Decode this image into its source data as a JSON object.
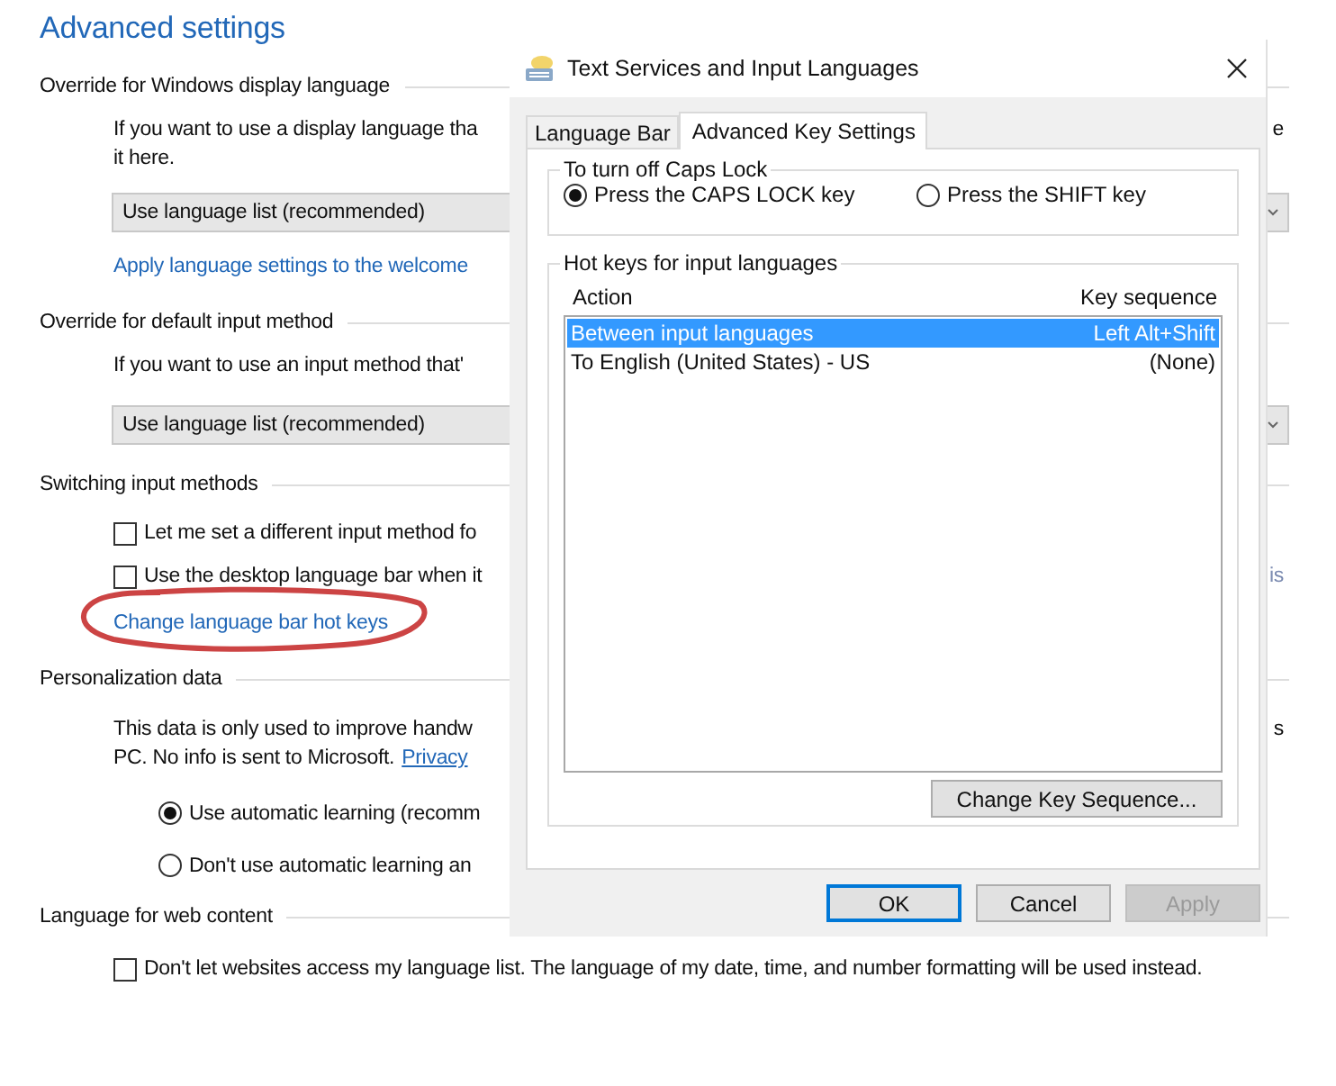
{
  "page": {
    "title": "Advanced settings",
    "sections": [
      {
        "heading": "Override for Windows display language",
        "items": [
          {
            "kind": "text",
            "lines": [
              "If you want to use a display language tha",
              "it here."
            ],
            "fragment": "e"
          },
          {
            "kind": "dropdown",
            "value": "Use language list (recommended)"
          },
          {
            "kind": "link",
            "text": "Apply language settings to the welcome"
          }
        ]
      },
      {
        "heading": "Override for default input method",
        "items": [
          {
            "kind": "text",
            "lines": [
              "If you want to use an input method that'"
            ]
          },
          {
            "kind": "dropdown",
            "value": "Use language list (recommended)"
          }
        ]
      },
      {
        "heading": "Switching input methods",
        "items": [
          {
            "kind": "checkbox",
            "label": "Let me set a different input method fo",
            "checked": false
          },
          {
            "kind": "checkbox",
            "label": "Use the desktop language bar when it",
            "checked": false,
            "fragment": "is"
          },
          {
            "kind": "link",
            "text": "Change language bar hot keys",
            "circled": true
          }
        ]
      },
      {
        "heading": "Personalization data",
        "items": [
          {
            "kind": "text",
            "lines": [
              "This data is only used to improve handw"
            ],
            "fragment": "s"
          },
          {
            "kind": "text_link",
            "text": "PC. No info is sent to Microsoft.",
            "link": "Privacy"
          },
          {
            "kind": "radio",
            "label": "Use automatic learning (recomm",
            "selected": true
          },
          {
            "kind": "radio",
            "label": "Don't use automatic learning an",
            "selected": false
          }
        ]
      },
      {
        "heading": "Language for web content",
        "items": [
          {
            "kind": "checkbox",
            "label": "Don't let websites access my language list. The language of my date, time, and number formatting will be used instead.",
            "checked": false
          }
        ]
      }
    ]
  },
  "dialog": {
    "title": "Text Services and Input Languages",
    "tabs": [
      {
        "label": "Language Bar",
        "selected": false
      },
      {
        "label": "Advanced Key Settings",
        "selected": true
      }
    ],
    "caps_group": {
      "title": "To turn off Caps Lock",
      "options": [
        {
          "label": "Press the CAPS LOCK key",
          "selected": true
        },
        {
          "label": "Press the SHIFT key",
          "selected": false
        }
      ]
    },
    "hotkeys_group": {
      "title": "Hot keys for input languages",
      "columns": [
        "Action",
        "Key sequence"
      ],
      "rows": [
        {
          "action": "Between input languages",
          "key": "Left Alt+Shift",
          "selected": true
        },
        {
          "action": "To English (United States) - US",
          "key": "(None)",
          "selected": false
        }
      ],
      "button": "Change Key Sequence..."
    },
    "buttons": [
      {
        "label": "OK",
        "kind": "default"
      },
      {
        "label": "Cancel",
        "kind": "normal"
      },
      {
        "label": "Apply",
        "kind": "disabled"
      }
    ]
  }
}
